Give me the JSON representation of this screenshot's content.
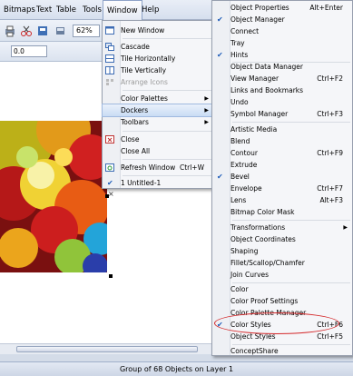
{
  "menubar": {
    "items": [
      "Bitmaps",
      "Text",
      "Table",
      "Tools",
      "Window",
      "Help"
    ],
    "active": "Window"
  },
  "toolbar": {
    "zoom": "62%"
  },
  "propbar": {
    "x_value": "0.0"
  },
  "window_menu": {
    "items": [
      {
        "label": "New Window",
        "icon": "new-window-icon"
      },
      {
        "label": "Cascade",
        "icon": "cascade-icon"
      },
      {
        "label": "Tile Horizontally",
        "icon": "tile-horizontal-icon"
      },
      {
        "label": "Tile Vertically",
        "icon": "tile-vertical-icon"
      },
      {
        "label": "Arrange Icons",
        "disabled": true
      },
      {
        "label": "Color Palettes",
        "submenu": true
      },
      {
        "label": "Dockers",
        "submenu": true,
        "highlight": true
      },
      {
        "label": "Toolbars",
        "submenu": true
      },
      {
        "label": "Close",
        "icon": "close-window-icon"
      },
      {
        "label": "Close All"
      },
      {
        "label": "Refresh Window",
        "shortcut": "Ctrl+W",
        "icon": "refresh-icon"
      },
      {
        "label": "1 Untitled-1",
        "checked": true
      }
    ]
  },
  "dockers_menu": {
    "items": [
      {
        "label": "Object Properties",
        "shortcut": "Alt+Enter"
      },
      {
        "label": "Object Manager",
        "checked": true
      },
      {
        "label": "Connect"
      },
      {
        "label": "Tray"
      },
      {
        "label": "Hints",
        "checked": true
      },
      {
        "label": "Object Data Manager"
      },
      {
        "label": "View Manager",
        "shortcut": "Ctrl+F2"
      },
      {
        "label": "Links and Bookmarks"
      },
      {
        "label": "Undo"
      },
      {
        "label": "Symbol Manager",
        "shortcut": "Ctrl+F3"
      },
      {
        "label": "Artistic Media"
      },
      {
        "label": "Blend"
      },
      {
        "label": "Contour",
        "shortcut": "Ctrl+F9"
      },
      {
        "label": "Extrude"
      },
      {
        "label": "Bevel",
        "checked": true
      },
      {
        "label": "Envelope",
        "shortcut": "Ctrl+F7"
      },
      {
        "label": "Lens",
        "shortcut": "Alt+F3"
      },
      {
        "label": "Bitmap Color Mask"
      },
      {
        "label": "Transformations",
        "submenu": true
      },
      {
        "label": "Object Coordinates"
      },
      {
        "label": "Shaping"
      },
      {
        "label": "Fillet/Scallop/Chamfer"
      },
      {
        "label": "Join Curves"
      },
      {
        "label": "Color"
      },
      {
        "label": "Color Proof Settings"
      },
      {
        "label": "Color Palette Manager"
      },
      {
        "label": "Color Styles",
        "shortcut": "Ctrl+F6",
        "checked": true
      },
      {
        "label": "Object Styles",
        "shortcut": "Ctrl+F5"
      },
      {
        "label": "ConceptShare"
      }
    ]
  },
  "status": {
    "text": "Group of 68 Objects on Layer 1"
  },
  "colors": {
    "callout": "#d4282a",
    "highlight": "#c9dcf4"
  }
}
